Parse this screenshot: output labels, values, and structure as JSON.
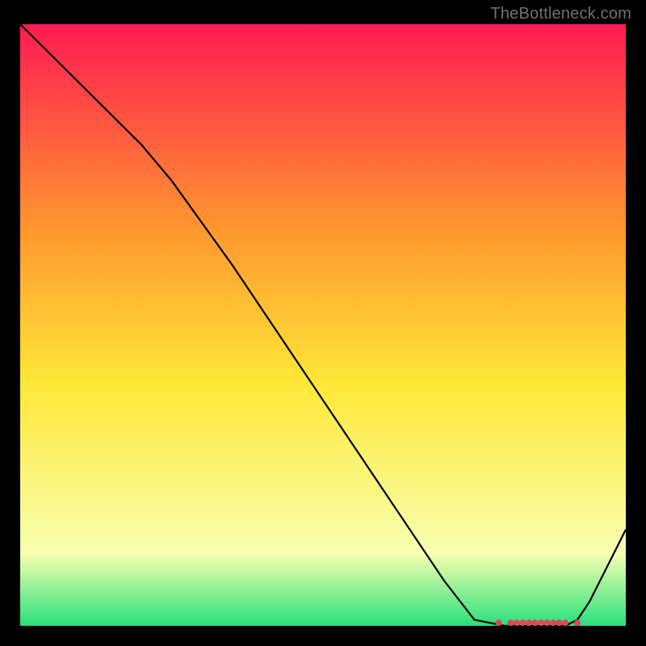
{
  "attribution": "TheBottleneck.com",
  "chart_data": {
    "type": "line",
    "title": "",
    "xlabel": "",
    "ylabel": "",
    "xlim": [
      0,
      100
    ],
    "ylim": [
      0,
      100
    ],
    "series": [
      {
        "name": "curve",
        "x": [
          0,
          5,
          10,
          15,
          20,
          25,
          30,
          35,
          40,
          45,
          50,
          55,
          60,
          65,
          70,
          75,
          80,
          82,
          84,
          86,
          88,
          90,
          92,
          94,
          96,
          98,
          100
        ],
        "y": [
          100,
          95,
          90,
          85,
          80,
          74,
          67,
          60,
          52.5,
          45,
          37.5,
          30,
          22.5,
          15,
          7.5,
          1,
          0,
          0,
          0,
          0,
          0,
          0,
          1,
          4,
          8,
          12,
          16
        ]
      }
    ],
    "markers": {
      "name": "highlight-points",
      "x": [
        79,
        81,
        82,
        83,
        84,
        85,
        86,
        87,
        88,
        89,
        90,
        92
      ],
      "y": [
        0.5,
        0.5,
        0.5,
        0.5,
        0.5,
        0.5,
        0.5,
        0.5,
        0.5,
        0.5,
        0.5,
        0.5
      ],
      "color": "#d94a56"
    },
    "gradient": {
      "top_color": "#ff1a52",
      "mid1_color": "#ff9a2e",
      "mid2_color": "#ffe838",
      "mid3_color": "#f7ffb0",
      "bottom_color": "#28e07a"
    }
  }
}
